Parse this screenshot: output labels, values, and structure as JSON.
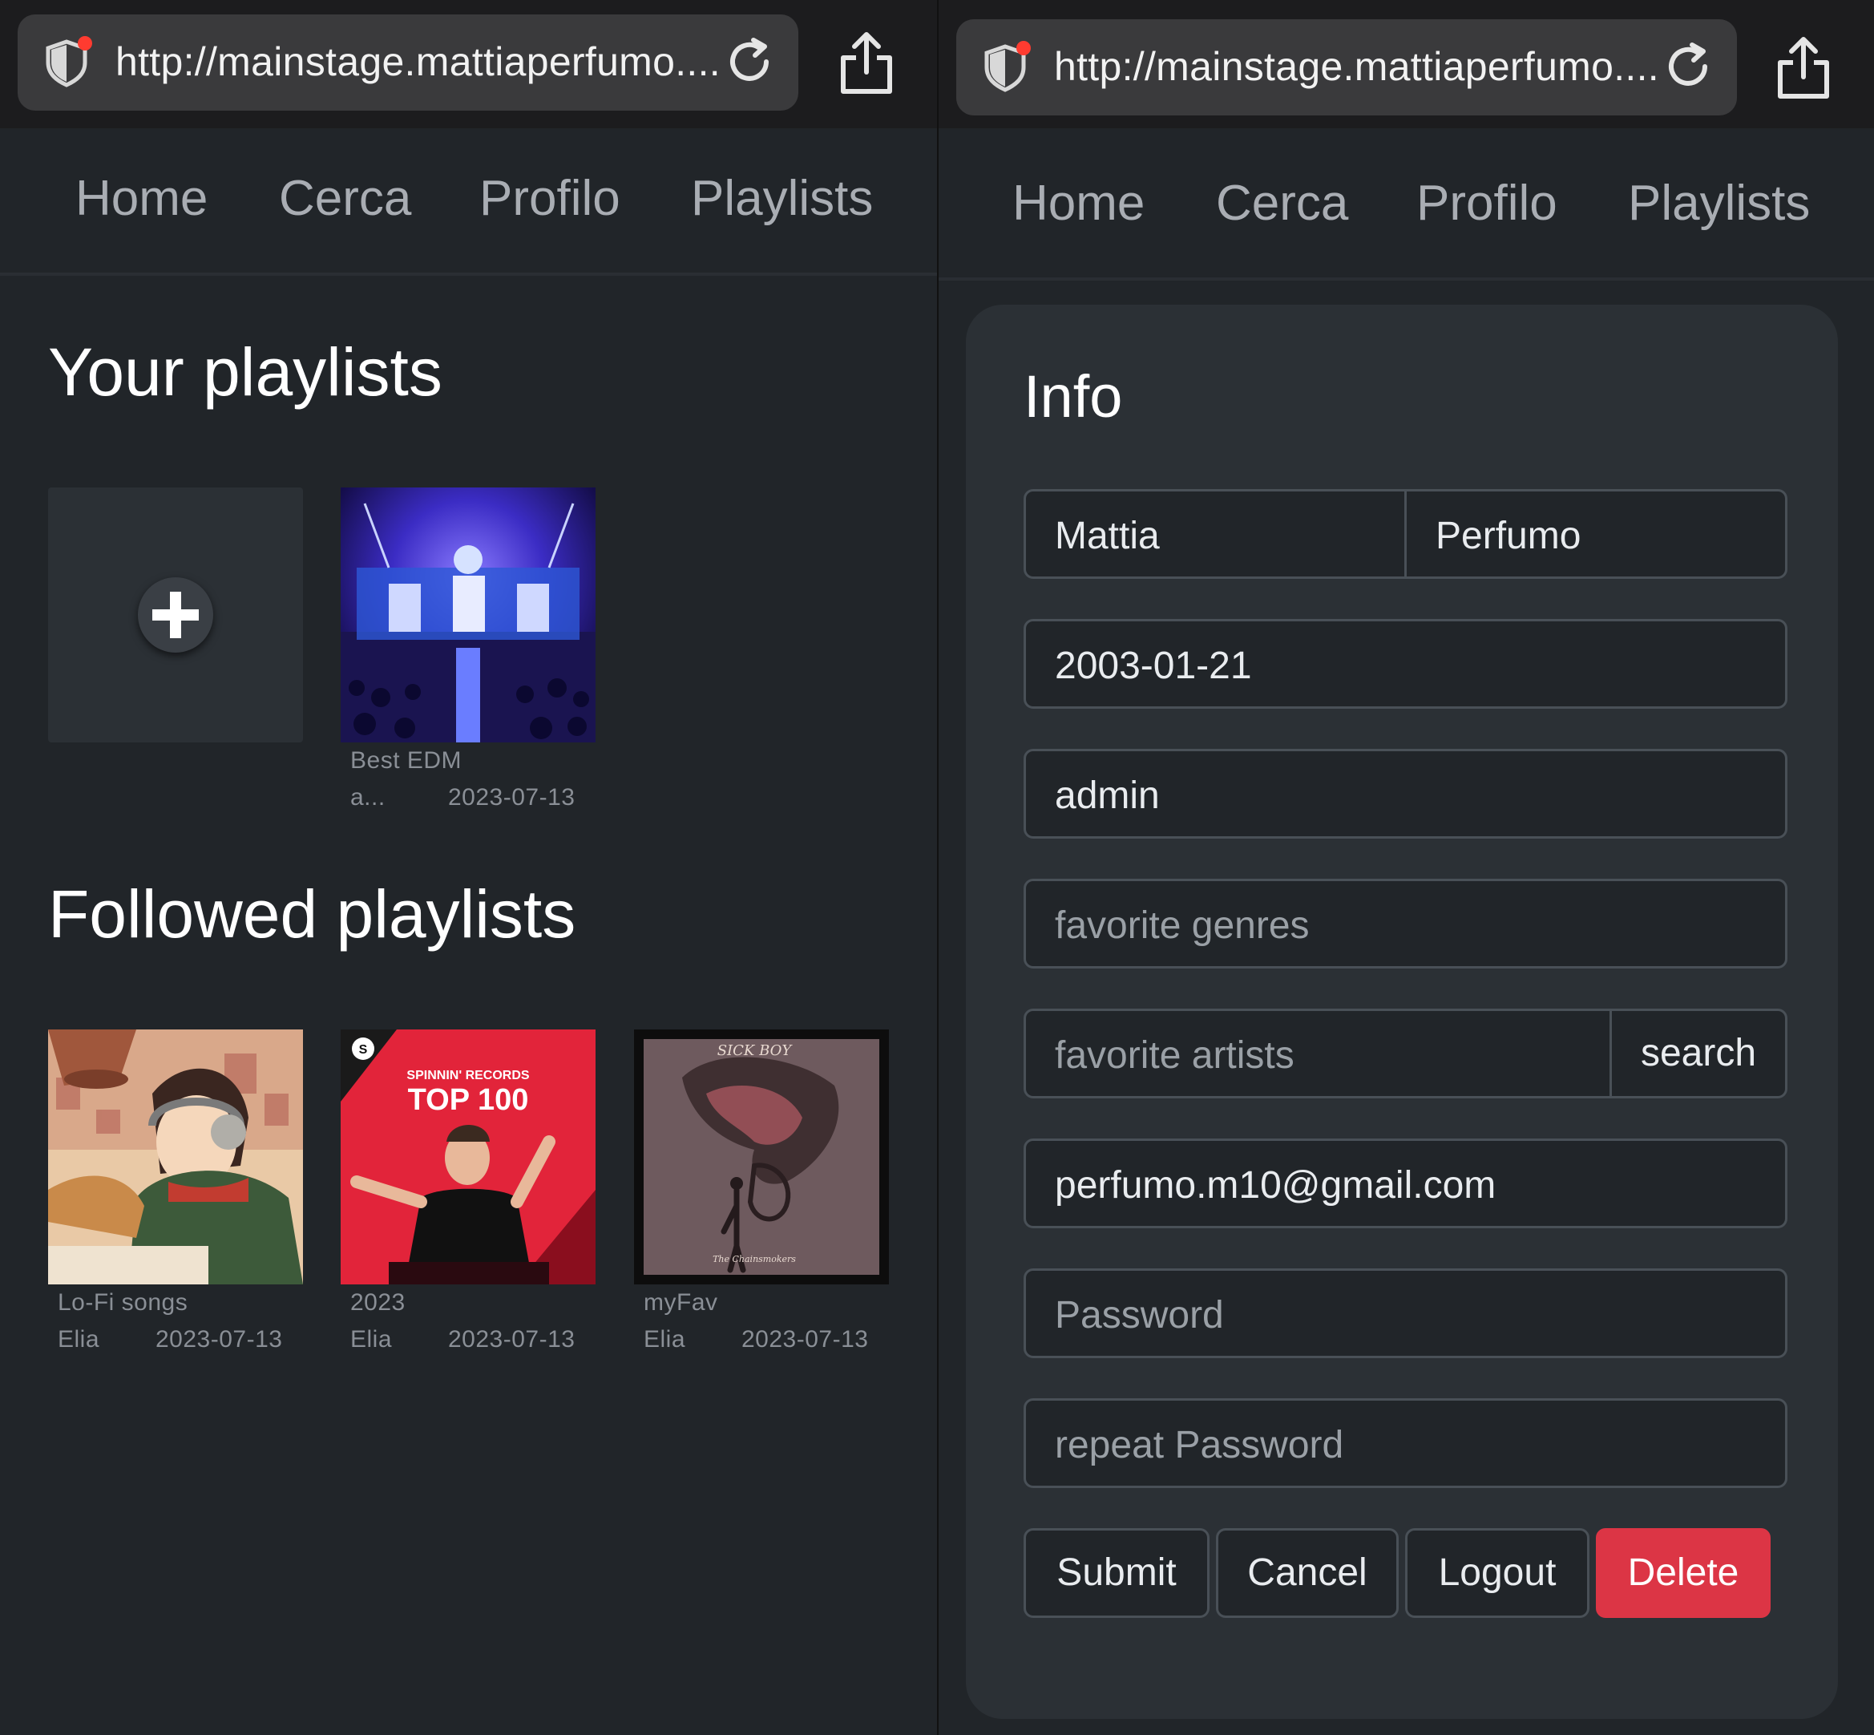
{
  "left": {
    "browser": {
      "url": "http://mainstage.mattiaperfumo...."
    },
    "nav": [
      "Home",
      "Cerca",
      "Profilo",
      "Playlists"
    ],
    "your_playlists": {
      "title": "Your playlists",
      "items": [
        {
          "name": "Best EDM",
          "owner": "a...",
          "date": "2023-07-13"
        }
      ]
    },
    "followed_playlists": {
      "title": "Followed playlists",
      "items": [
        {
          "name": "Lo-Fi songs",
          "owner": "Elia",
          "date": "2023-07-13"
        },
        {
          "name": "2023",
          "owner": "Elia",
          "date": "2023-07-13",
          "cover_text": [
            "SPINNIN' RECORDS",
            "TOP 100"
          ]
        },
        {
          "name": "myFav",
          "owner": "Elia",
          "date": "2023-07-13",
          "cover_text": [
            "SICK BOY",
            "The Chainsmokers"
          ]
        }
      ]
    }
  },
  "right": {
    "browser": {
      "url": "http://mainstage.mattiaperfumo...."
    },
    "nav": [
      "Home",
      "Cerca",
      "Profilo",
      "Playlists"
    ],
    "form": {
      "title": "Info",
      "first_name": "Mattia",
      "last_name": "Perfumo",
      "birthdate": "2003-01-21",
      "username": "admin",
      "genres_placeholder": "favorite genres",
      "artists_placeholder": "favorite artists",
      "search_label": "search",
      "email": "perfumo.m10@gmail.com",
      "password_placeholder": "Password",
      "repeat_password_placeholder": "repeat Password",
      "buttons": {
        "submit": "Submit",
        "cancel": "Cancel",
        "logout": "Logout",
        "delete": "Delete"
      }
    }
  },
  "colors": {
    "danger": "#dc3545",
    "privacy_dot": "#ff3b30",
    "background": "#212529"
  }
}
